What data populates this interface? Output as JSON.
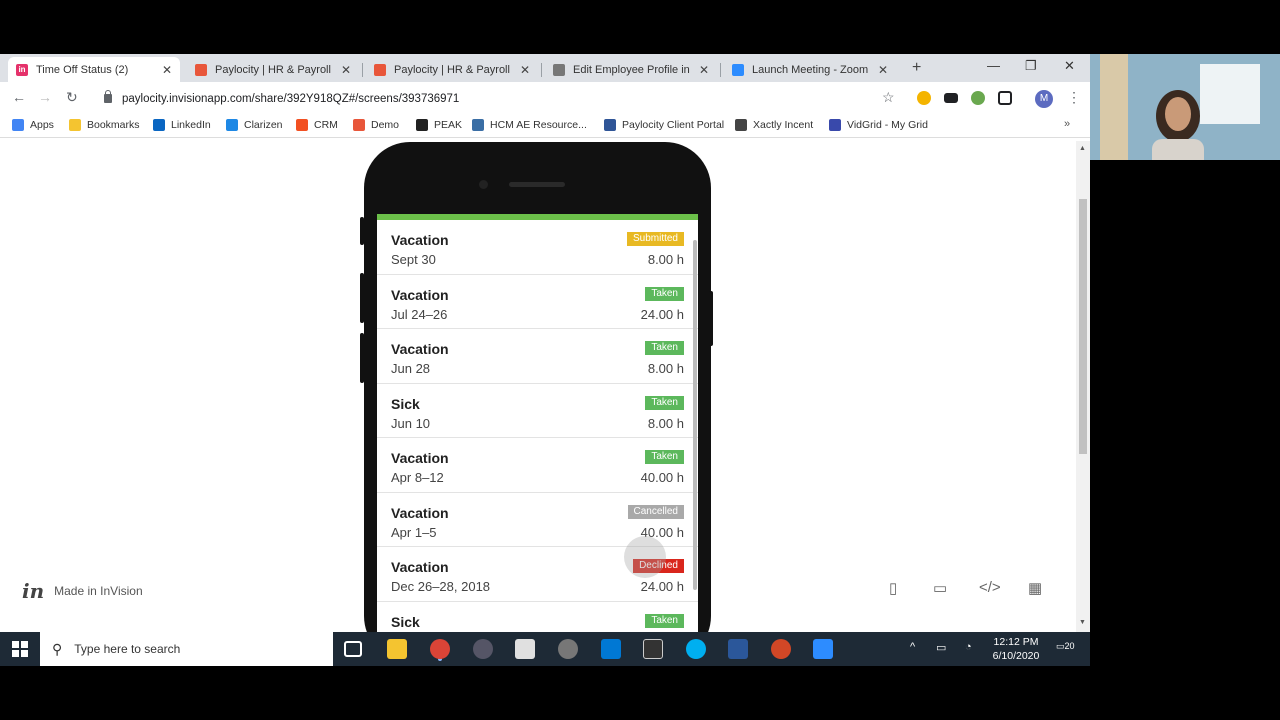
{
  "browser": {
    "tabs": [
      {
        "label": "Time Off Status (2)",
        "fav_color": "#e5326b",
        "fav_text": "in",
        "active": true
      },
      {
        "label": "Paylocity | HR & Payroll",
        "fav_color": "#e8563a",
        "fav_text": "",
        "active": false
      },
      {
        "label": "Paylocity | HR & Payroll",
        "fav_color": "#e8563a",
        "fav_text": "",
        "active": false
      },
      {
        "label": "Edit Employee Profile in the",
        "fav_color": "#777777",
        "fav_text": "",
        "active": false
      },
      {
        "label": "Launch Meeting - Zoom",
        "fav_color": "#2d8cff",
        "fav_text": "",
        "active": false
      }
    ],
    "url": "paylocity.invisionapp.com/share/392Y918QZ#/screens/393736971",
    "avatar": "M",
    "bookmarks": [
      {
        "label": "Apps",
        "color": "#4285f4"
      },
      {
        "label": "Bookmarks",
        "color": "#f4c430"
      },
      {
        "label": "LinkedIn",
        "color": "#0a66c2"
      },
      {
        "label": "Clarizen",
        "color": "#1e88e5"
      },
      {
        "label": "CRM",
        "color": "#f25022"
      },
      {
        "label": "Demo",
        "color": "#e8563a"
      },
      {
        "label": "PEAK",
        "color": "#222222"
      },
      {
        "label": "HCM AE Resource...",
        "color": "#3a6ea5"
      },
      {
        "label": "Paylocity Client Portal",
        "color": "#2f5597"
      },
      {
        "label": "Xactly Incent",
        "color": "#444444"
      },
      {
        "label": "VidGrid - My Grid",
        "color": "#3949ab"
      }
    ]
  },
  "timeoff": {
    "items": [
      {
        "type": "Vacation",
        "date": "Sept 30",
        "status": "Submitted",
        "status_color": "#e8b923",
        "hours": "8.00 h"
      },
      {
        "type": "Vacation",
        "date": "Jul 24–26",
        "status": "Taken",
        "status_color": "#5cb85c",
        "hours": "24.00 h"
      },
      {
        "type": "Vacation",
        "date": "Jun 28",
        "status": "Taken",
        "status_color": "#5cb85c",
        "hours": "8.00 h"
      },
      {
        "type": "Sick",
        "date": "Jun 10",
        "status": "Taken",
        "status_color": "#5cb85c",
        "hours": "8.00 h"
      },
      {
        "type": "Vacation",
        "date": "Apr 8–12",
        "status": "Taken",
        "status_color": "#5cb85c",
        "hours": "40.00 h"
      },
      {
        "type": "Vacation",
        "date": "Apr 1–5",
        "status": "Cancelled",
        "status_color": "#a9a9a9",
        "hours": "40.00 h"
      },
      {
        "type": "Vacation",
        "date": "Dec 26–28, 2018",
        "status": "Declined",
        "status_color": "#d9261c",
        "hours": "24.00 h"
      },
      {
        "type": "Sick",
        "date": "",
        "status": "Taken",
        "status_color": "#5cb85c",
        "hours": ""
      }
    ]
  },
  "invision": {
    "logo": "in",
    "label": "Made in InVision"
  },
  "taskbar": {
    "search_placeholder": "Type here to search",
    "time": "12:12 PM",
    "date": "6/10/2020",
    "notifications": "20"
  }
}
